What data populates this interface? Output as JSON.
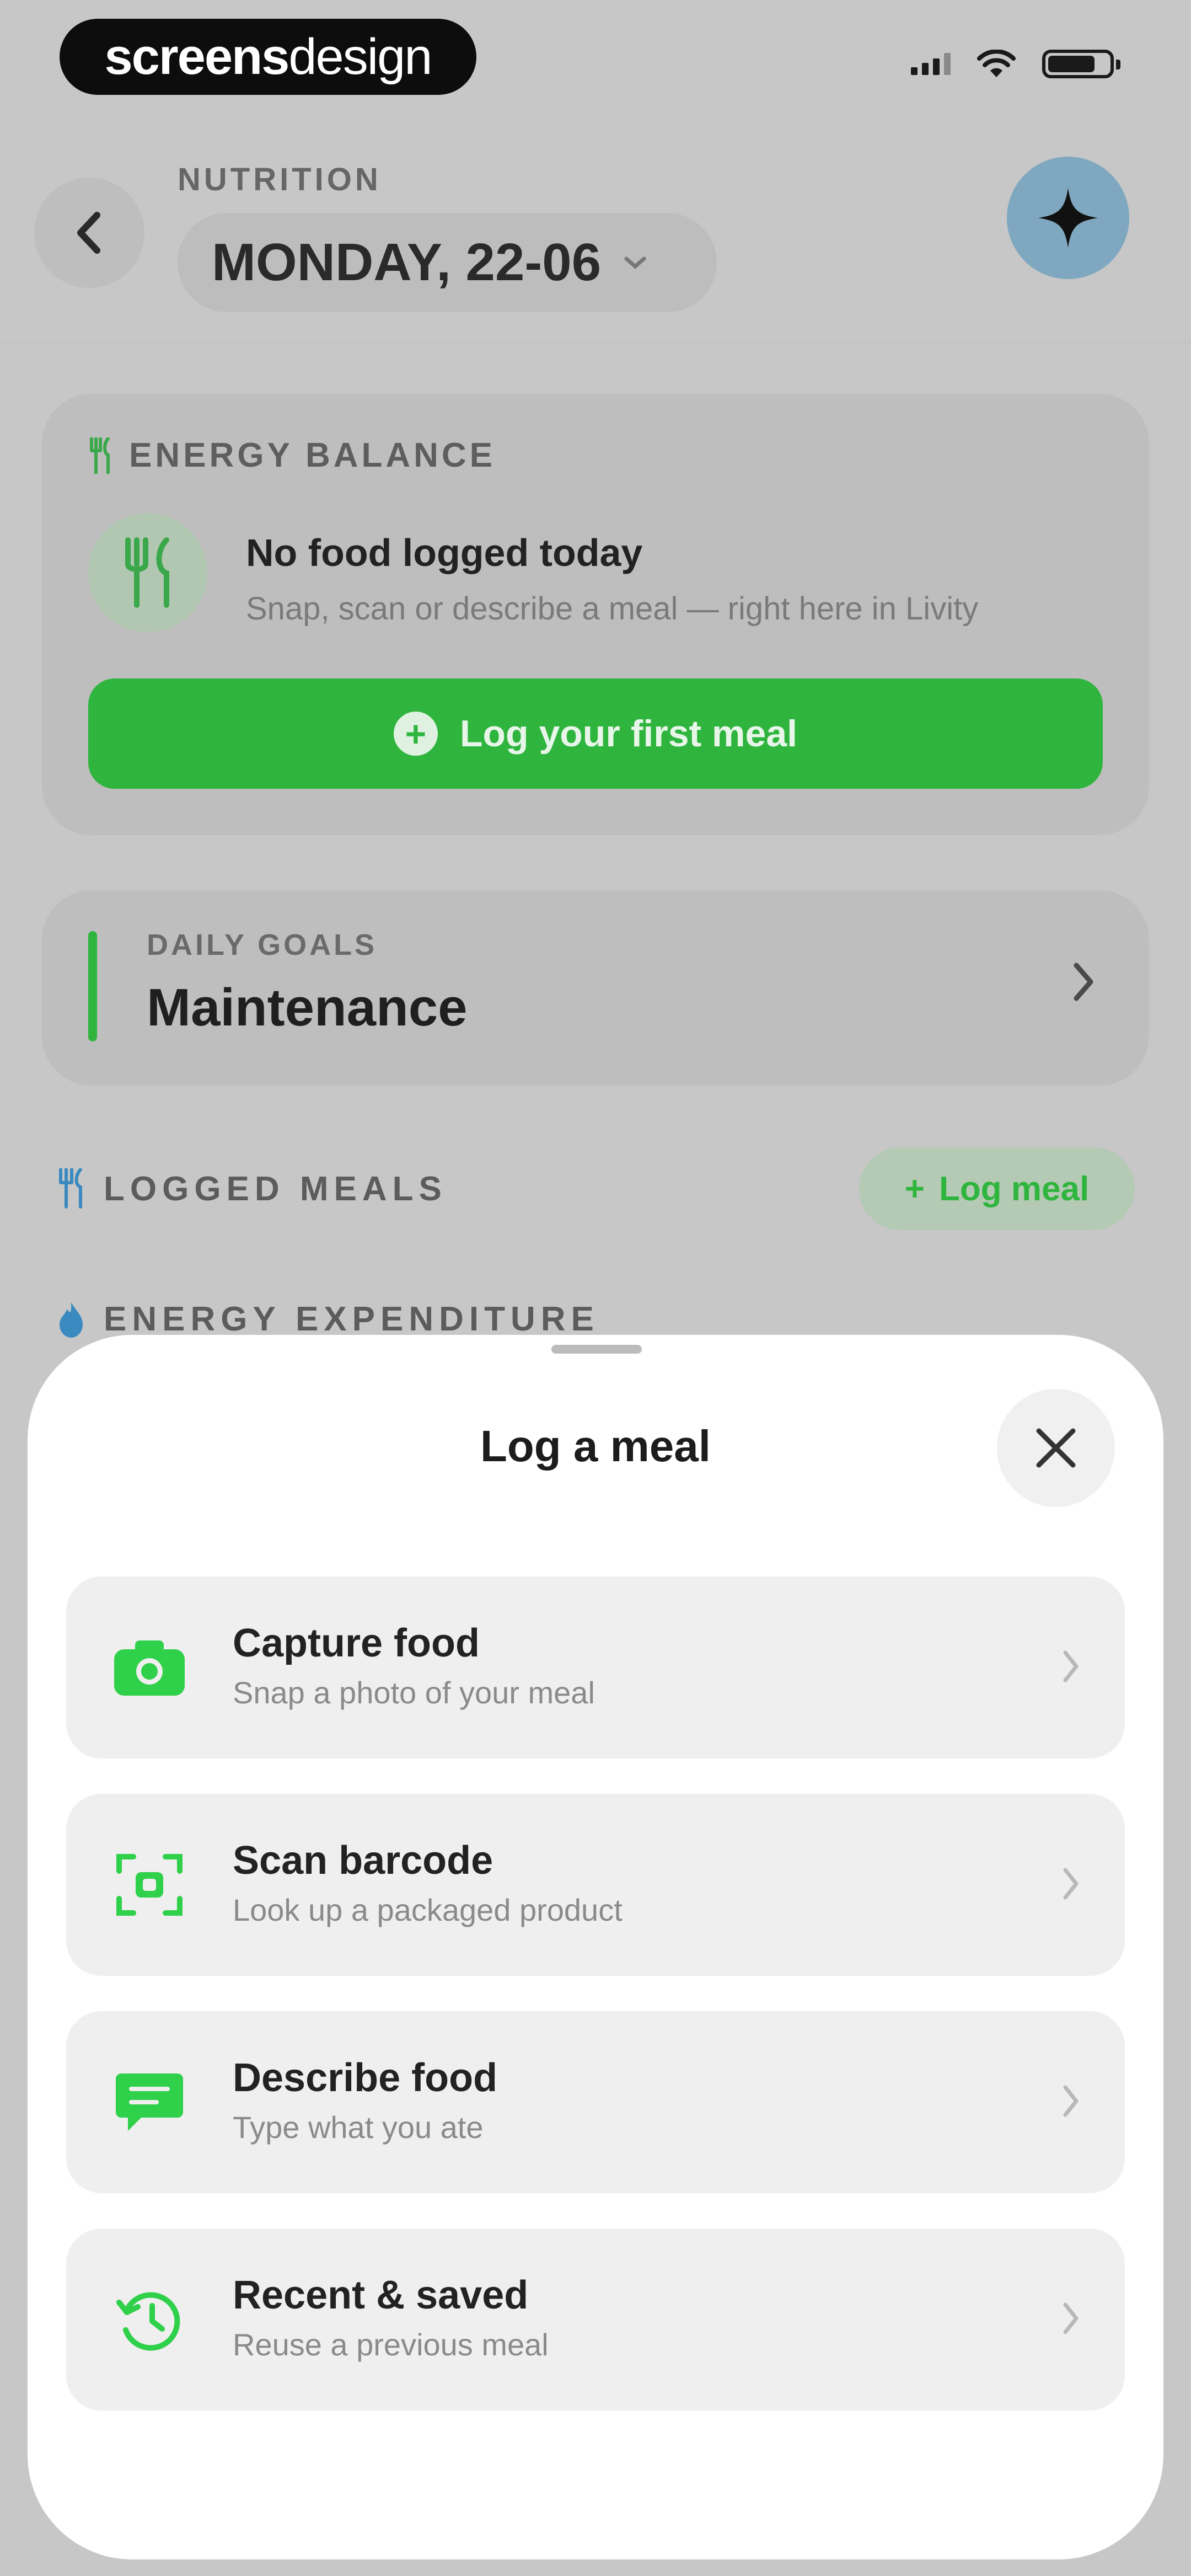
{
  "status_bar": {
    "logo_bold": "screens",
    "logo_light": "design"
  },
  "header": {
    "eyebrow": "NUTRITION",
    "date": "MONDAY, 22-06"
  },
  "energy_balance": {
    "eyebrow": "ENERGY BALANCE",
    "title": "No food logged today",
    "subtitle": "Snap, scan or describe a meal — right here in Livity",
    "button_label": "Log your first meal"
  },
  "daily_goals": {
    "eyebrow": "DAILY GOALS",
    "title": "Maintenance"
  },
  "sections": {
    "logged_meals": "LOGGED MEALS",
    "log_meal_chip": "Log meal",
    "energy_expenditure": "ENERGY EXPENDITURE"
  },
  "sheet": {
    "title": "Log a meal",
    "options": [
      {
        "title": "Capture food",
        "subtitle": "Snap a photo of your meal",
        "icon": "camera-icon"
      },
      {
        "title": "Scan barcode",
        "subtitle": "Look up a packaged product",
        "icon": "barcode-scan-icon"
      },
      {
        "title": "Describe food",
        "subtitle": "Type what you ate",
        "icon": "chat-bubble-icon"
      },
      {
        "title": "Recent & saved",
        "subtitle": "Reuse a previous meal",
        "icon": "history-icon"
      }
    ]
  },
  "colors": {
    "accent_green": "#2fb53e",
    "sheet_bg": "#ffffff",
    "dim_bg": "#c6c7c6"
  }
}
